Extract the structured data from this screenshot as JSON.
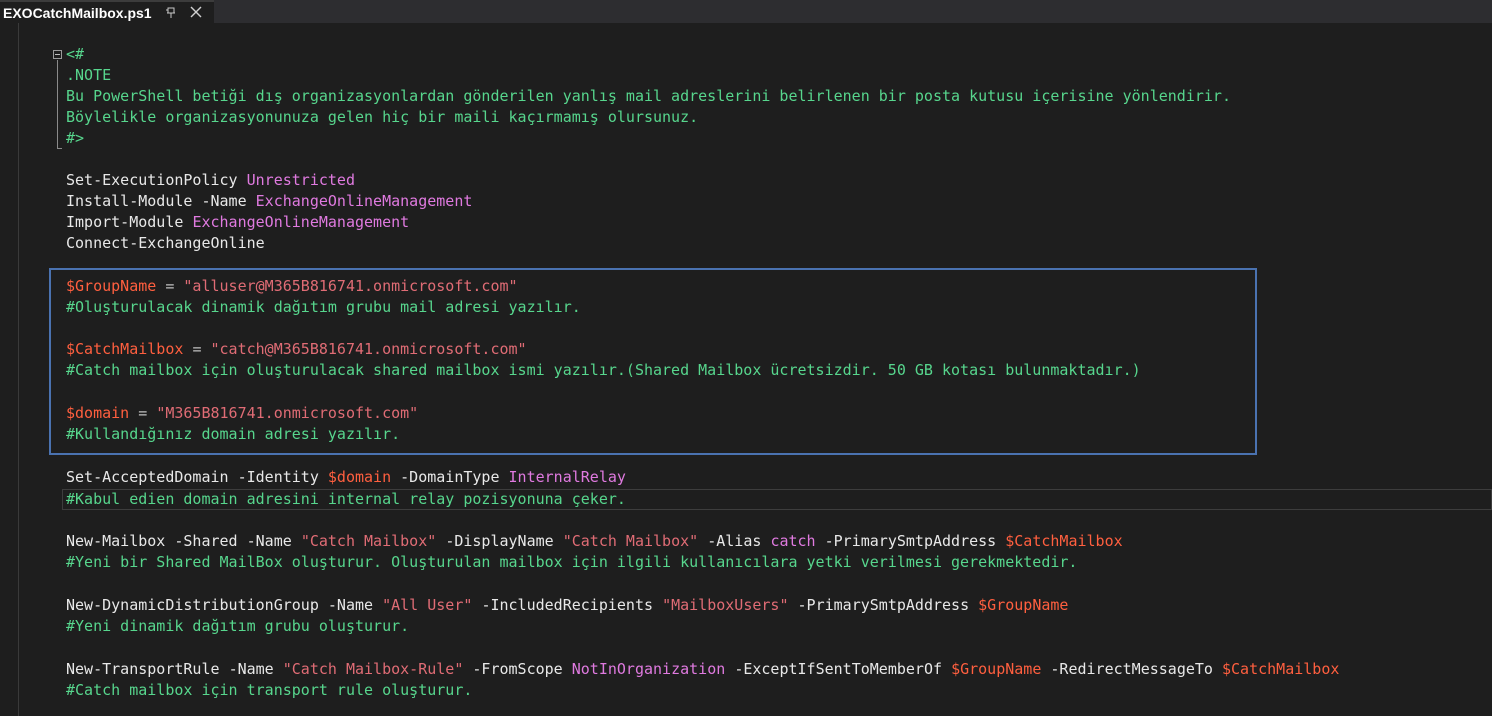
{
  "tab": {
    "title": "EXOCatchMailbox.ps1",
    "pin_icon": "pin-icon",
    "close_icon": "close-icon"
  },
  "colors": {
    "comment": "#57d68d",
    "keyword": "#e8e8e8",
    "parameter_value": "#e07ae0",
    "variable": "#ff5f3f",
    "string": "#e06c75",
    "highlight_border": "#4a72b0",
    "background": "#1e1e1e"
  },
  "code": {
    "l1": "<#",
    "l2": ".NOTE",
    "l3": "Bu PowerShell betiği dış organizasyonlardan gönderilen yanlış mail adreslerini belirlenen bir posta kutusu içerisine yönlendirir.",
    "l4": "Böylelikle organizasyonunuza gelen hiç bir maili kaçırmamış olursunuz.",
    "l5": "#>",
    "l7_cmd": "Set-ExecutionPolicy",
    "l7_val": "Unrestricted",
    "l8_cmd": "Install-Module",
    "l8_param": "-Name",
    "l8_val": "ExchangeOnlineManagement",
    "l9_cmd": "Import-Module",
    "l9_val": "ExchangeOnlineManagement",
    "l10_cmd": "Connect-ExchangeOnline",
    "l12_var": "$GroupName",
    "l12_op": "=",
    "l12_str": "\"alluser@M365B816741.onmicrosoft.com\"",
    "l13": "#Oluşturulacak dinamik dağıtım grubu mail adresi yazılır.",
    "l15_var": "$CatchMailbox",
    "l15_op": "=",
    "l15_str": "\"catch@M365B816741.onmicrosoft.com\"",
    "l16": "#Catch mailbox için oluşturulacak shared mailbox ismi yazılır.(Shared Mailbox ücretsizdir. 50 GB kotası bulunmaktadır.)",
    "l18_var": "$domain",
    "l18_op": "=",
    "l18_str": "\"M365B816741.onmicrosoft.com\"",
    "l19": "#Kullandığınız domain adresi yazılır.",
    "l21_cmd": "Set-AcceptedDomain",
    "l21_p1": "-Identity",
    "l21_var": "$domain",
    "l21_p2": "-DomainType",
    "l21_val": "InternalRelay",
    "l22": "#Kabul edien domain adresini internal relay pozisyonuna çeker.",
    "l24_cmd": "New-Mailbox",
    "l24_p1": "-Shared",
    "l24_p2": "-Name",
    "l24_s1": "\"Catch Mailbox\"",
    "l24_p3": "-DisplayName",
    "l24_s2": "\"Catch Mailbox\"",
    "l24_p4": "-Alias",
    "l24_val": "catch",
    "l24_p5": "-PrimarySmtpAddress",
    "l24_var": "$CatchMailbox",
    "l25": "#Yeni bir Shared MailBox oluşturur. Oluşturulan mailbox için ilgili kullanıcılara yetki verilmesi gerekmektedir.",
    "l27_cmd": "New-DynamicDistributionGroup",
    "l27_p1": "-Name",
    "l27_s1": "\"All User\"",
    "l27_p2": "-IncludedRecipients",
    "l27_s2": "\"MailboxUsers\"",
    "l27_p3": "-PrimarySmtpAddress",
    "l27_var": "$GroupName",
    "l28": "#Yeni dinamik dağıtım grubu oluşturur.",
    "l30_cmd": "New-TransportRule",
    "l30_p1": "-Name",
    "l30_s1": "\"Catch Mailbox-Rule\"",
    "l30_p2": "-FromScope",
    "l30_val": "NotInOrganization",
    "l30_p3": "-ExceptIfSentToMemberOf",
    "l30_var1": "$GroupName",
    "l30_p4": "-RedirectMessageTo",
    "l30_var2": "$CatchMailbox",
    "l31": "#Catch mailbox için transport rule oluşturur."
  }
}
